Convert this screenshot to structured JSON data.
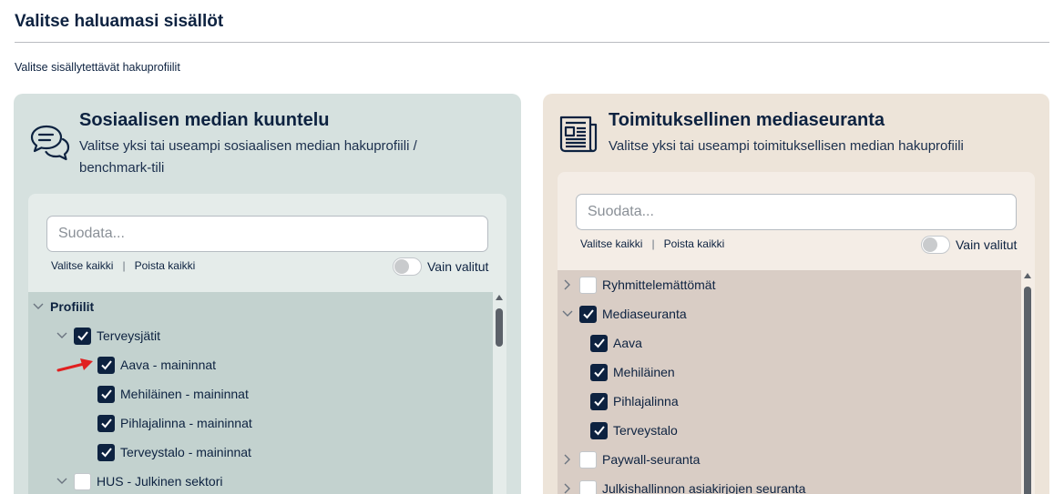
{
  "page": {
    "title": "Valitse haluamasi sisällöt",
    "subtitle": "Valitse sisällytettävät hakuprofiilit"
  },
  "colors": {
    "navy": "#0d2240",
    "left_panel_bg": "#d6e1df",
    "right_panel_bg": "#ede4d9",
    "left_tree_bg": "#c3d2cf",
    "right_tree_bg": "#d9cdc5"
  },
  "left_panel": {
    "icon": "chat-bubbles-icon",
    "heading": "Sosiaalisen median kuuntelu",
    "description": "Valitse yksi tai useampi sosiaalisen median hakuprofiili / benchmark-tili",
    "filter_placeholder": "Suodata...",
    "select_all": "Valitse kaikki",
    "separator": "|",
    "clear_all": "Poista kaikki",
    "toggle_label": "Vain valitut",
    "toggle_on": false,
    "tree": [
      {
        "label": "Profiilit",
        "level": 0,
        "expanded": true,
        "checkbox": false,
        "bold": true
      },
      {
        "label": "Terveysjätit",
        "level": 1,
        "expanded": true,
        "checkbox": true,
        "checked": true
      },
      {
        "label": "Aava - maininnat",
        "level": 2,
        "checkbox": true,
        "checked": true,
        "highlighted": true
      },
      {
        "label": "Mehiläinen - maininnat",
        "level": 2,
        "checkbox": true,
        "checked": true
      },
      {
        "label": "Pihlajalinna - maininnat",
        "level": 2,
        "checkbox": true,
        "checked": true
      },
      {
        "label": "Terveystalo - maininnat",
        "level": 2,
        "checkbox": true,
        "checked": true
      },
      {
        "label": "HUS - Julkinen sektori",
        "level": 1,
        "expanded": true,
        "checkbox": true,
        "checked": false
      }
    ]
  },
  "right_panel": {
    "icon": "newspaper-icon",
    "heading": "Toimituksellinen mediaseuranta",
    "description": "Valitse yksi tai useampi toimituksellisen median hakuprofiili",
    "filter_placeholder": "Suodata...",
    "select_all": "Valitse kaikki",
    "separator": "|",
    "clear_all": "Poista kaikki",
    "toggle_label": "Vain valitut",
    "toggle_on": false,
    "tree": [
      {
        "label": "Ryhmittelemättömät",
        "level": 0,
        "expanded": false,
        "checkbox": true,
        "checked": false
      },
      {
        "label": "Mediaseuranta",
        "level": 0,
        "expanded": true,
        "checkbox": true,
        "checked": true
      },
      {
        "label": "Aava",
        "level": 1,
        "checkbox": true,
        "checked": true
      },
      {
        "label": "Mehiläinen",
        "level": 1,
        "checkbox": true,
        "checked": true
      },
      {
        "label": "Pihlajalinna",
        "level": 1,
        "checkbox": true,
        "checked": true
      },
      {
        "label": "Terveystalo",
        "level": 1,
        "checkbox": true,
        "checked": true
      },
      {
        "label": "Paywall-seuranta",
        "level": 0,
        "expanded": false,
        "checkbox": true,
        "checked": false
      },
      {
        "label": "Julkishallinnon asiakirjojen seuranta",
        "level": 0,
        "expanded": false,
        "checkbox": true,
        "checked": false
      }
    ]
  }
}
